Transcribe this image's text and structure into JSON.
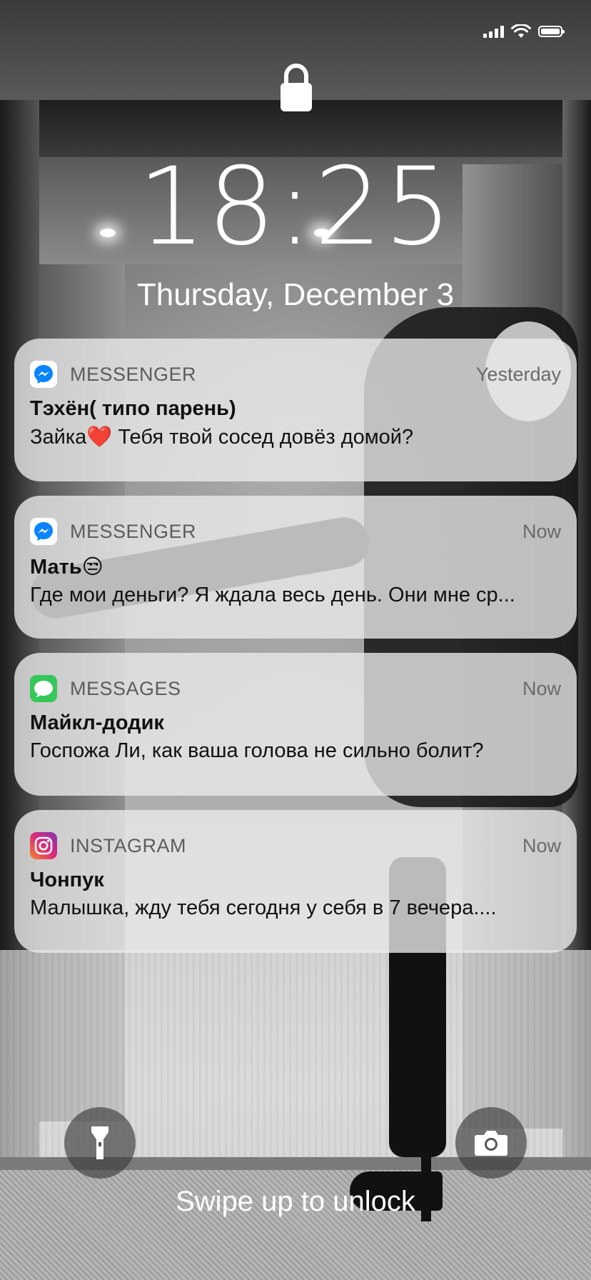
{
  "status_bar": {
    "battery_level": 1.0
  },
  "lock_screen": {
    "time": "18:25",
    "date": "Thursday, December 3",
    "swipe_hint": "Swipe up to unlock"
  },
  "notifications": [
    {
      "app": "MESSENGER",
      "icon": "messenger-icon",
      "time": "Yesterday",
      "title": "Тэхён( типо парень)",
      "body": "Зайка❤️ Тебя твой сосед довёз домой?"
    },
    {
      "app": "MESSENGER",
      "icon": "messenger-icon",
      "time": "Now",
      "title": "Мать😒",
      "body": "Где мои деньги? Я ждала весь день. Они мне ср..."
    },
    {
      "app": "MESSAGES",
      "icon": "messages-icon",
      "time": "Now",
      "title": "Майкл-додик",
      "body": "Госпожа Ли, как ваша голова не сильно болит?"
    },
    {
      "app": "INSTAGRAM",
      "icon": "instagram-icon",
      "time": "Now",
      "title": "Чонпук",
      "body": "Малышка, жду тебя сегодня у себя в 7 вечера...."
    }
  ],
  "colors": {
    "messenger": "#0a84ff",
    "messages": "#34c759",
    "instagram_start": "#f58529",
    "instagram_end": "#8134af"
  }
}
